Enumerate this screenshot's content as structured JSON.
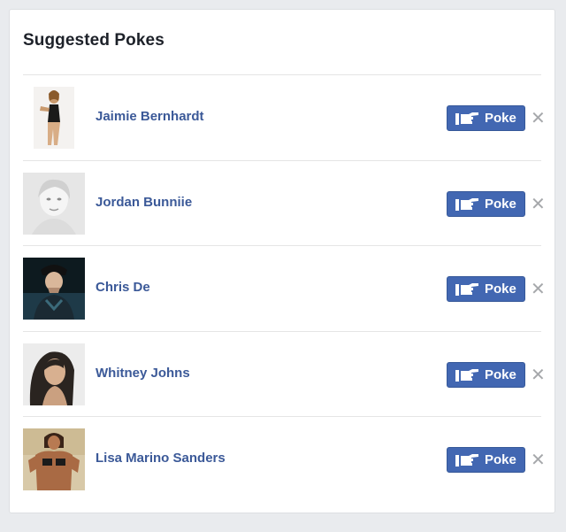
{
  "panel": {
    "title": "Suggested Pokes"
  },
  "colors": {
    "page_background": "#e9ebee",
    "name_link": "#3b5998",
    "poke_button": "#4267b2",
    "dismiss": "#a6a8ab"
  },
  "suggestions": [
    {
      "name": "Jaimie Bernhardt",
      "poke_label": "Poke",
      "dismiss_icon": "close-icon"
    },
    {
      "name": "Jordan Bunniie",
      "poke_label": "Poke",
      "dismiss_icon": "close-icon"
    },
    {
      "name": "Chris De",
      "poke_label": "Poke",
      "dismiss_icon": "close-icon"
    },
    {
      "name": "Whitney Johns",
      "poke_label": "Poke",
      "dismiss_icon": "close-icon"
    },
    {
      "name": "Lisa Marino Sanders",
      "poke_label": "Poke",
      "dismiss_icon": "close-icon"
    }
  ]
}
